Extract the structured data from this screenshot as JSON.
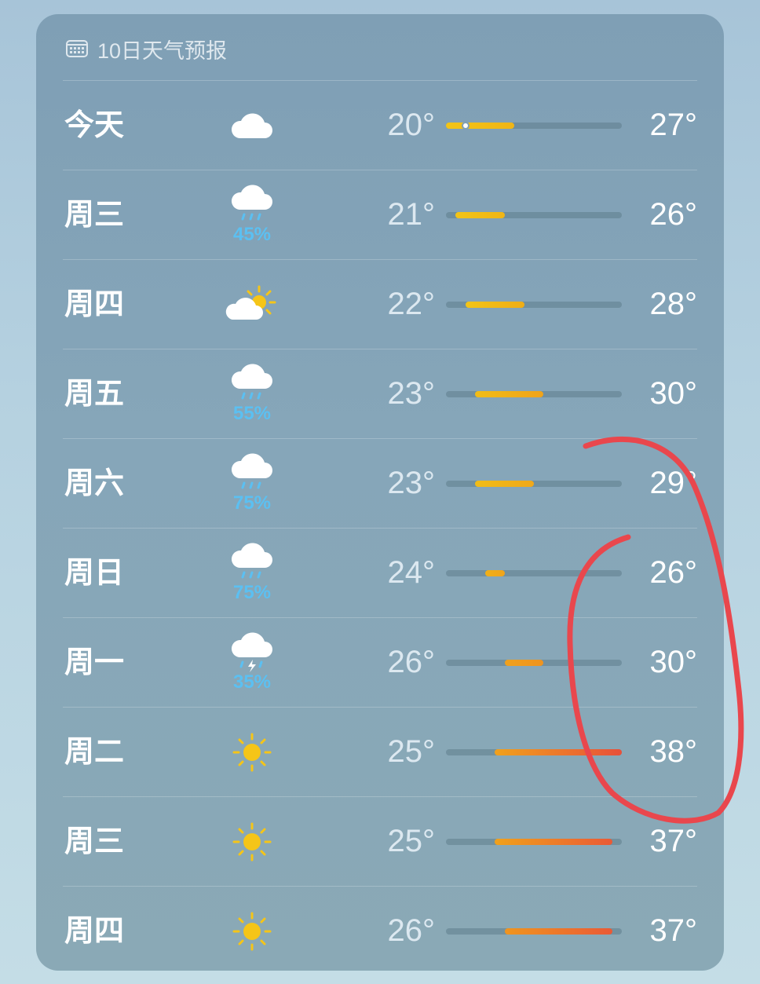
{
  "header": {
    "title": "10日天气预报",
    "icon": "calendar-icon"
  },
  "colors": {
    "bar_track": "#5f7d8c",
    "rain_pct": "#5bc0f2",
    "annotation": "#e9474d"
  },
  "forecast": [
    {
      "day": "今天",
      "icon": "cloud-icon",
      "precip": "",
      "low": "20°",
      "high": "27°",
      "range": [
        20,
        27
      ],
      "current": 22,
      "colors": [
        "#f2c417",
        "#f0b516"
      ]
    },
    {
      "day": "周三",
      "icon": "cloud-rain-icon",
      "precip": "45%",
      "low": "21°",
      "high": "26°",
      "range": [
        21,
        26
      ],
      "colors": [
        "#f2c417",
        "#f0b516"
      ]
    },
    {
      "day": "周四",
      "icon": "cloud-sun-icon",
      "precip": "",
      "low": "22°",
      "high": "28°",
      "range": [
        22,
        28
      ],
      "colors": [
        "#f2c417",
        "#f0ad16"
      ]
    },
    {
      "day": "周五",
      "icon": "cloud-rain-icon",
      "precip": "55%",
      "low": "23°",
      "high": "30°",
      "range": [
        23,
        30
      ],
      "colors": [
        "#f1bd17",
        "#f0a31a"
      ]
    },
    {
      "day": "周六",
      "icon": "cloud-rain-icon",
      "precip": "75%",
      "low": "23°",
      "high": "29°",
      "range": [
        23,
        29
      ],
      "colors": [
        "#f1bd17",
        "#f0a81a"
      ]
    },
    {
      "day": "周日",
      "icon": "cloud-rain-icon",
      "precip": "75%",
      "low": "24°",
      "high": "26°",
      "range": [
        24,
        26
      ],
      "colors": [
        "#f0b017",
        "#f0a41b"
      ]
    },
    {
      "day": "周一",
      "icon": "cloud-bolt-rain-icon",
      "precip": "35%",
      "low": "26°",
      "high": "30°",
      "range": [
        26,
        30
      ],
      "colors": [
        "#f0a11c",
        "#ef931f"
      ]
    },
    {
      "day": "周二",
      "icon": "sun-icon",
      "precip": "",
      "low": "25°",
      "high": "38°",
      "range": [
        25,
        38
      ],
      "colors": [
        "#f0a11c",
        "#e8503a"
      ]
    },
    {
      "day": "周三",
      "icon": "sun-icon",
      "precip": "",
      "low": "25°",
      "high": "37°",
      "range": [
        25,
        37
      ],
      "colors": [
        "#f0a11c",
        "#ea5a36"
      ]
    },
    {
      "day": "周四",
      "icon": "sun-icon",
      "precip": "",
      "low": "26°",
      "high": "37°",
      "range": [
        26,
        37
      ],
      "colors": [
        "#ef951f",
        "#ea5a36"
      ]
    }
  ],
  "scale": {
    "min": 20,
    "max": 38
  }
}
